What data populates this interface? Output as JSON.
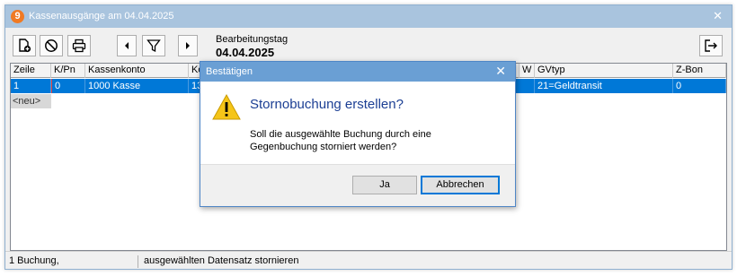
{
  "window": {
    "title": "Kassenausgänge am 04.04.2025",
    "badge": "9",
    "close_glyph": "✕"
  },
  "toolbar": {
    "buttons": [
      {
        "name": "new-entry-button",
        "icon": "add-document-icon"
      },
      {
        "name": "cancel-entry-button",
        "icon": "prohibited-icon"
      },
      {
        "name": "print-button",
        "icon": "printer-icon"
      },
      {
        "name": "previous-button",
        "icon": "triangle-left-icon"
      },
      {
        "name": "filter-button",
        "icon": "filter-funnel-icon"
      },
      {
        "name": "next-button",
        "icon": "triangle-right-icon"
      },
      {
        "name": "exit-button",
        "icon": "exit-arrow-icon"
      }
    ],
    "workday_label": "Bearbeitungstag",
    "workday_value": "04.04.2025"
  },
  "grid": {
    "columns": [
      "Zeile",
      "K/Pn",
      "Kassenkonto",
      "Ko",
      "W",
      "GVtyp",
      "Z-Bon"
    ],
    "selected_row": {
      "zeile": "1",
      "kpn": "0",
      "kassenkonto": "1000 Kasse",
      "ko": "13",
      "w": "",
      "gvtyp": "21=Geldtransit",
      "zbon": "0"
    },
    "new_row_label": "<neu>"
  },
  "status": {
    "left": "1 Buchung,",
    "right": "ausgewählten Datensatz stornieren"
  },
  "dialog": {
    "title": "Bestätigen",
    "close_glyph": "✕",
    "heading": "Stornobuchung erstellen?",
    "message_line1": "Soll die ausgewählte Buchung durch eine",
    "message_line2": "Gegenbuchung storniert werden?",
    "yes_label": "Ja",
    "cancel_label": "Abbrechen",
    "icon": "warning-icon"
  },
  "colors": {
    "titlebar": "#a9c4de",
    "selection": "#0078d7",
    "dialog_titlebar": "#6a9fd4",
    "heading": "#1c3f94",
    "app_badge": "#f07a24",
    "warning": "#f5c518"
  }
}
